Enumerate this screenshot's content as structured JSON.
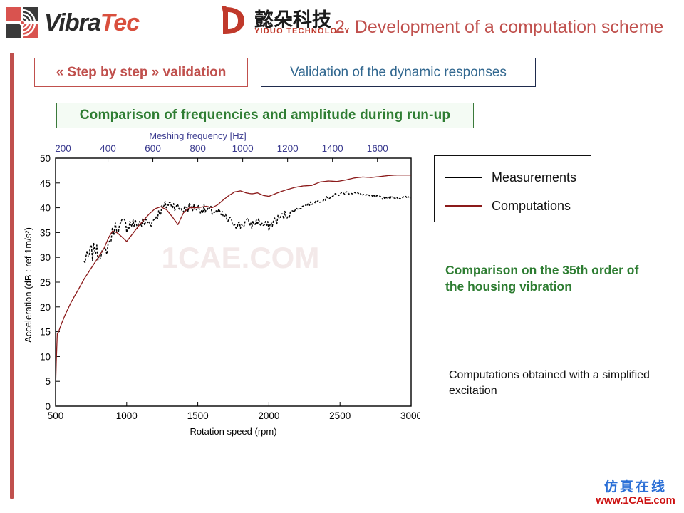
{
  "header": {
    "vibratec_logo": {
      "word_a": "Vibra",
      "word_b": "Tec",
      "icon": "vibratec-spiral-mark"
    },
    "yiduo_logo": {
      "mark": "yiduo-d-mark",
      "chinese": "懿朵科技",
      "english": "YIDUO TECHNOLOGY"
    },
    "slide_title": "2. Development of a computation scheme",
    "title_color": "#c0504d"
  },
  "tabs": [
    {
      "label": "« Step by step » validation",
      "state": "active",
      "color": "#c0504d"
    },
    {
      "label": "Validation of the dynamic responses",
      "state": "inactive",
      "color": "#31678f"
    }
  ],
  "section_heading": {
    "label": "Comparison of frequencies and amplitude during run-up",
    "color": "#2e7d32"
  },
  "legend": {
    "items": [
      {
        "label": "Measurements",
        "color": "#000000",
        "style": "solid"
      },
      {
        "label": "Computations",
        "color": "#8b1a1a",
        "style": "solid"
      }
    ]
  },
  "notes": {
    "green_note": "Comparison on the 35th order of the housing vibration",
    "black_note": "Computations obtained with a simplified excitation"
  },
  "watermarks": {
    "chart_overlay": "1CAE.COM",
    "corner_cn": "仿真在线",
    "corner_en": "www.1CAE.com"
  },
  "chart_data": {
    "type": "line",
    "title": "",
    "xlabel": "Rotation speed (rpm)",
    "ylabel": "Acceleration (dB : ref 1m/s²)",
    "top_axis_label": "Meshing frequency [Hz]",
    "xlim": [
      500,
      3000
    ],
    "ylim": [
      0,
      50
    ],
    "xticks": [
      500,
      1000,
      1500,
      2000,
      2500,
      3000
    ],
    "yticks": [
      0,
      5,
      10,
      15,
      20,
      25,
      30,
      35,
      40,
      45,
      50
    ],
    "top_xticks": [
      200,
      400,
      600,
      800,
      1000,
      1200,
      1400,
      1600
    ],
    "top_xlim": [
      166.67,
      1750
    ],
    "grid": false,
    "legend_position": "outside-right",
    "series": [
      {
        "name": "Measurements",
        "color": "#000000",
        "style": "dotted-noisy",
        "x": [
          700,
          715,
          730,
          745,
          760,
          775,
          790,
          805,
          820,
          835,
          850,
          870,
          890,
          910,
          930,
          950,
          975,
          1000,
          1030,
          1060,
          1090,
          1120,
          1150,
          1180,
          1210,
          1240,
          1270,
          1300,
          1330,
          1360,
          1400,
          1440,
          1480,
          1520,
          1560,
          1600,
          1640,
          1680,
          1720,
          1760,
          1800,
          1840,
          1880,
          1920,
          1960,
          2000,
          2040,
          2080,
          2120,
          2160,
          2200,
          2260,
          2320,
          2380,
          2440,
          2500,
          2560,
          2620,
          2680,
          2740,
          2800,
          2860,
          2920,
          2980,
          3000
        ],
        "y": [
          28.9,
          30.2,
          29.6,
          31.4,
          30.6,
          32.3,
          31.0,
          30.5,
          31.6,
          30.4,
          31.2,
          32.6,
          34.0,
          35.8,
          36.3,
          36.0,
          36.8,
          36.4,
          36.9,
          36.5,
          37.0,
          36.8,
          37.2,
          37.1,
          38.4,
          39.5,
          40.4,
          40.8,
          40.6,
          40.0,
          39.6,
          40.2,
          40.0,
          39.8,
          39.5,
          39.3,
          39.0,
          38.3,
          37.4,
          36.9,
          36.4,
          37.1,
          36.6,
          37.3,
          36.5,
          36.2,
          37.4,
          38.0,
          38.6,
          39.2,
          39.8,
          40.5,
          41.1,
          41.6,
          42.3,
          42.8,
          43.1,
          42.9,
          42.5,
          42.2,
          42.0,
          42.1,
          42.0,
          42.0,
          42.0
        ]
      },
      {
        "name": "Computations",
        "color": "#8b1a1a",
        "style": "solid",
        "x": [
          500,
          505,
          512,
          520,
          540,
          570,
          610,
          650,
          700,
          750,
          800,
          840,
          870,
          900,
          930,
          960,
          1000,
          1040,
          1080,
          1120,
          1160,
          1200,
          1240,
          1280,
          1320,
          1360,
          1400,
          1440,
          1480,
          1520,
          1560,
          1600,
          1640,
          1680,
          1720,
          1760,
          1800,
          1840,
          1880,
          1920,
          1960,
          2000,
          2060,
          2120,
          2180,
          2240,
          2300,
          2360,
          2420,
          2480,
          2540,
          2600,
          2660,
          2720,
          2780,
          2840,
          2900,
          2960,
          3000
        ],
        "y": [
          3.5,
          9.0,
          14.6,
          14.9,
          16.5,
          18.6,
          21.0,
          23.0,
          25.6,
          27.8,
          30.0,
          31.8,
          33.8,
          35.3,
          35.0,
          34.3,
          33.2,
          34.7,
          36.2,
          37.5,
          38.8,
          39.8,
          40.2,
          39.6,
          38.2,
          36.6,
          39.0,
          40.0,
          40.0,
          40.1,
          40.3,
          40.0,
          40.6,
          41.6,
          42.5,
          43.2,
          43.4,
          43.0,
          42.8,
          43.0,
          42.5,
          42.3,
          43.0,
          43.6,
          44.1,
          44.4,
          44.5,
          45.2,
          45.4,
          45.3,
          45.6,
          46.0,
          46.2,
          46.1,
          46.3,
          46.5,
          46.6,
          46.6,
          46.6
        ]
      }
    ]
  }
}
